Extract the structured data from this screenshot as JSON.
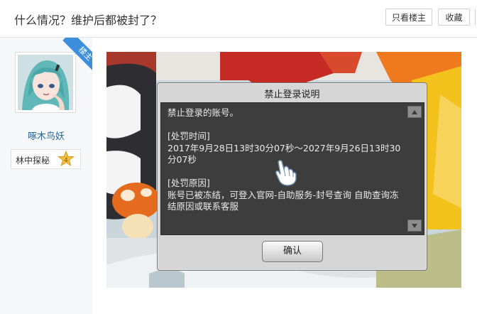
{
  "header": {
    "title": "什么情况？维护后都被封了？",
    "author_only_label": "只看楼主",
    "favorite_label": "收藏"
  },
  "user": {
    "ribbon": "楼主",
    "name": "啄木鸟妖",
    "rank_title": "林中探秘",
    "level": "4"
  },
  "dialog": {
    "title": "禁止登录说明",
    "line1": "禁止登录的账号。",
    "period_heading": "[处罚时间]",
    "period_value": "2017年9月28日13时30分07秒～2027年9月26日13时30分07秒",
    "reason_heading": "[处罚原因]",
    "reason_value": "账号已被冻结，可登入官网-自助服务-封号查询 自助查询冻结原因或联系客服",
    "ok_label": "确认"
  }
}
